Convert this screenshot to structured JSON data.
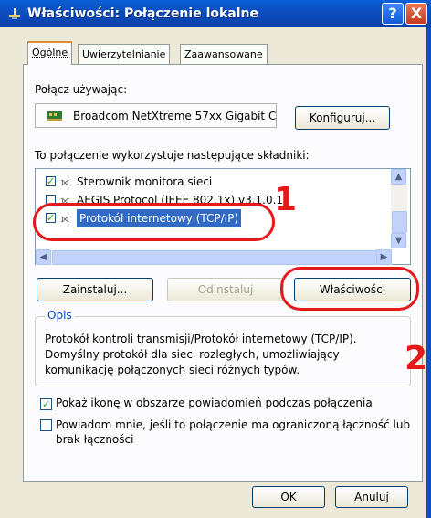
{
  "window": {
    "title": "Właściwości: Połączenie lokalne",
    "help_label": "?",
    "close_label": "X"
  },
  "tabs": [
    {
      "label": "Ogólne",
      "active": true
    },
    {
      "label": "Uwierzytelnianie"
    },
    {
      "label": "Zaawansowane"
    }
  ],
  "connect_using": {
    "label": "Połącz używając:",
    "adapter": "Broadcom NetXtreme 57xx Gigabit C",
    "configure_button": "Konfiguruj..."
  },
  "components": {
    "label": "To połączenie wykorzystuje następujące składniki:",
    "items": [
      {
        "label": "Sterownik monitora sieci",
        "checked": true
      },
      {
        "label": "AEGIS Protocol (IEEE 802.1x) v3.1.0.1",
        "checked": false
      },
      {
        "label": "Protokół internetowy (TCP/IP)",
        "checked": true,
        "selected": true
      }
    ]
  },
  "buttons": {
    "install": "Zainstaluj...",
    "uninstall": "Odinstaluj",
    "properties": "Właściwości",
    "ok": "OK",
    "cancel": "Anuluj"
  },
  "description": {
    "title": "Opis",
    "text": "Protokół kontroli transmisji/Protokół internetowy (TCP/IP). Domyślny protokół dla sieci rozległych, umożliwiający komunikację połączonych sieci różnych typów."
  },
  "options": [
    {
      "label": "Pokaż ikonę w obszarze powiadomień podczas połączenia",
      "checked": true
    },
    {
      "label": "Powiadom mnie, jeśli to połączenie ma ograniczoną łączność lub brak łączności",
      "checked": false
    }
  ],
  "annotations": {
    "step1": "1",
    "step2": "2",
    "color": "#e41a1a"
  }
}
